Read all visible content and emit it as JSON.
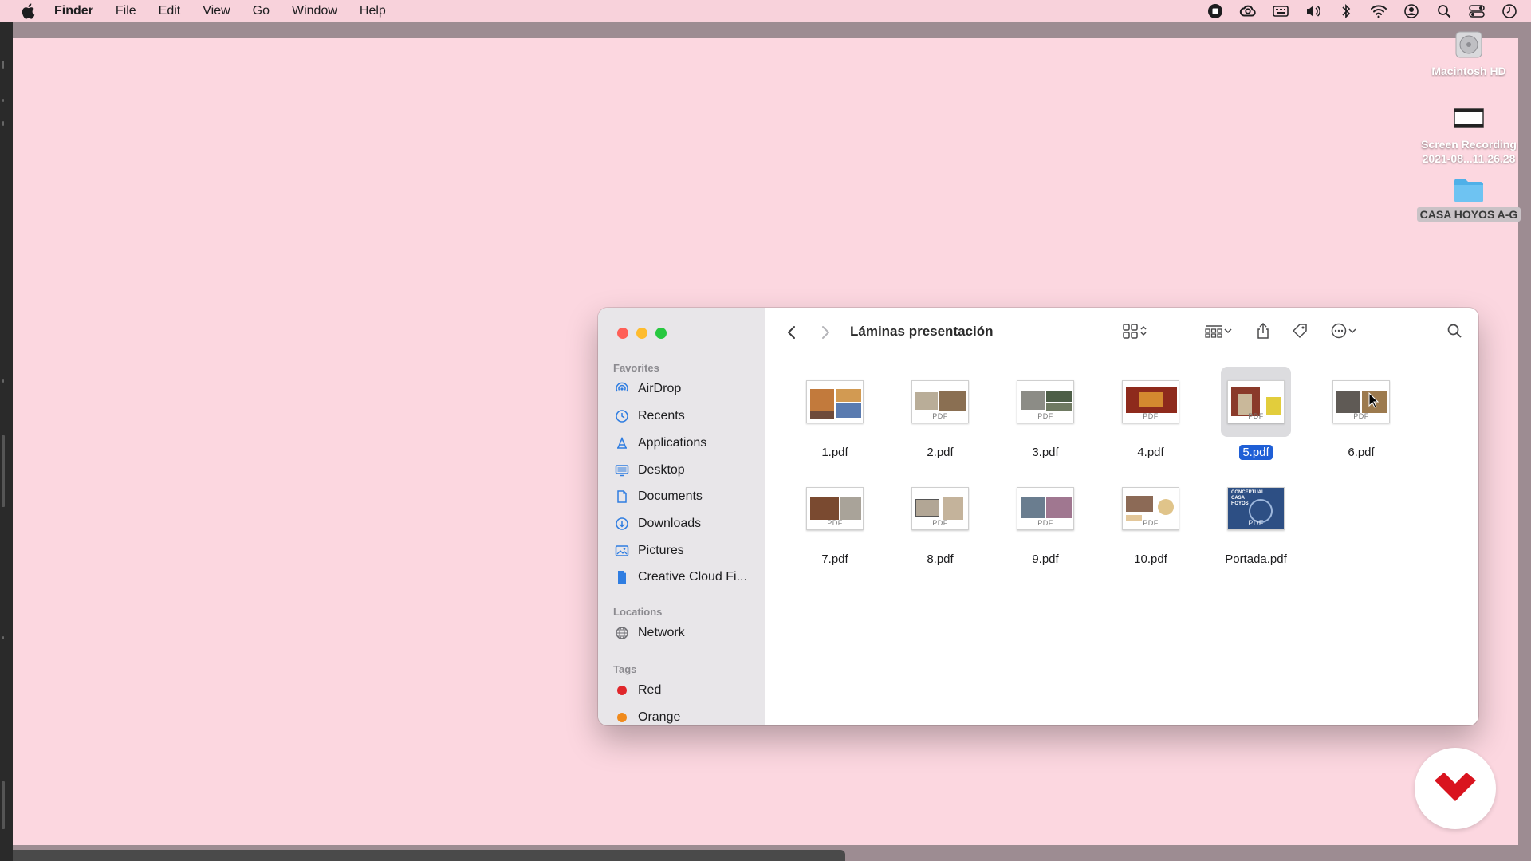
{
  "menubar": {
    "app": "Finder",
    "items": [
      "File",
      "Edit",
      "View",
      "Go",
      "Window",
      "Help"
    ]
  },
  "status_icons": [
    "record-stop-icon",
    "creative-cloud-icon",
    "keyboard-input-icon",
    "volume-icon",
    "bluetooth-icon",
    "wifi-icon",
    "user-account-icon",
    "spotlight-search-icon",
    "control-center-icon",
    "clock-icon"
  ],
  "desktop": {
    "icons": [
      {
        "label": "Macintosh HD",
        "kind": "drive"
      },
      {
        "label": "Screen Recording",
        "label2": "2021-08...11.26.28",
        "kind": "video"
      },
      {
        "label": "CASA HOYOS A-G",
        "kind": "folder"
      }
    ]
  },
  "finder": {
    "title": "Láminas presentación",
    "sidebar": {
      "favorites_header": "Favorites",
      "favorites": [
        {
          "label": "AirDrop",
          "icon": "airdrop-icon"
        },
        {
          "label": "Recents",
          "icon": "clock-icon"
        },
        {
          "label": "Applications",
          "icon": "applications-icon"
        },
        {
          "label": "Desktop",
          "icon": "desktop-icon"
        },
        {
          "label": "Documents",
          "icon": "document-icon"
        },
        {
          "label": "Downloads",
          "icon": "download-icon"
        },
        {
          "label": "Pictures",
          "icon": "photo-icon"
        },
        {
          "label": "Creative Cloud Fi...",
          "icon": "file-icon"
        }
      ],
      "locations_header": "Locations",
      "locations": [
        {
          "label": "Network",
          "icon": "globe-icon"
        }
      ],
      "tags_header": "Tags",
      "tags": [
        {
          "label": "Red",
          "color": "#e0262b"
        },
        {
          "label": "Orange",
          "color": "#f08a1c"
        }
      ]
    },
    "files": [
      {
        "name": "1.pdf",
        "selected": false,
        "pdf_mark": ""
      },
      {
        "name": "2.pdf",
        "selected": false,
        "pdf_mark": "PDF"
      },
      {
        "name": "3.pdf",
        "selected": false,
        "pdf_mark": "PDF"
      },
      {
        "name": "4.pdf",
        "selected": false,
        "pdf_mark": "PDF"
      },
      {
        "name": "5.pdf",
        "selected": true,
        "pdf_mark": "PDF"
      },
      {
        "name": "6.pdf",
        "selected": false,
        "pdf_mark": "PDF"
      },
      {
        "name": "7.pdf",
        "selected": false,
        "pdf_mark": "PDF"
      },
      {
        "name": "8.pdf",
        "selected": false,
        "pdf_mark": "PDF"
      },
      {
        "name": "9.pdf",
        "selected": false,
        "pdf_mark": "PDF"
      },
      {
        "name": "10.pdf",
        "selected": false,
        "pdf_mark": "PDF"
      },
      {
        "name": "Portada.pdf",
        "selected": false,
        "pdf_mark": "PDF"
      }
    ],
    "portada_heading": "CONCEPTUAL CASA HOYOS"
  },
  "colors": {
    "desktop_bg": "#fcd7e0",
    "selection": "#1f5fd6",
    "close": "#ff5f57",
    "minimize": "#febc2e",
    "zoom": "#28c840",
    "logo_red": "#d9141f"
  }
}
